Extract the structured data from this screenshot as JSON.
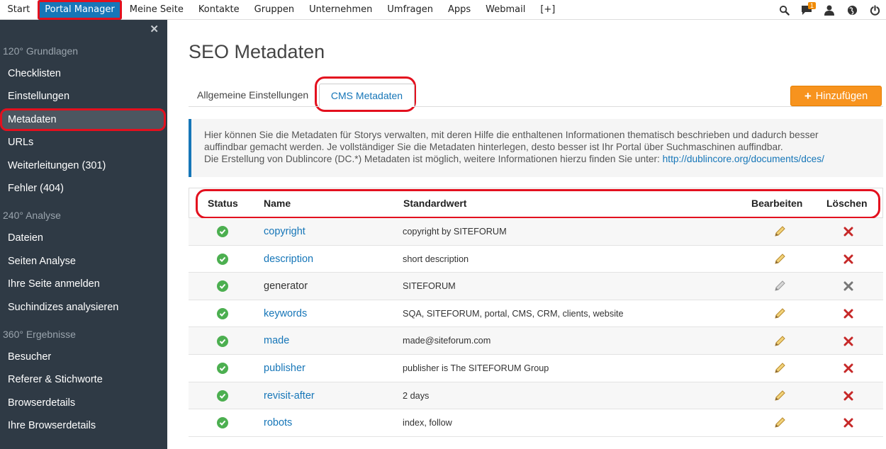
{
  "topnav": {
    "items": [
      "Start",
      "Portal Manager",
      "Meine Seite",
      "Kontakte",
      "Gruppen",
      "Unternehmen",
      "Umfragen",
      "Apps",
      "Webmail",
      "[+]"
    ],
    "active_index": 1,
    "notification_count": "1"
  },
  "sidebar": {
    "close_label": "✕",
    "sections": [
      {
        "label": "120° Grundlagen",
        "items": [
          "Checklisten",
          "Einstellungen",
          "Metadaten",
          "URLs",
          "Weiterleitungen (301)",
          "Fehler (404)"
        ]
      },
      {
        "label": "240° Analyse",
        "items": [
          "Dateien",
          "Seiten Analyse",
          "Ihre Seite anmelden",
          "Suchindizes analysieren"
        ]
      },
      {
        "label": "360° Ergebnisse",
        "items": [
          "Besucher",
          "Referer & Stichworte",
          "Browserdetails",
          "Ihre Browserdetails"
        ]
      }
    ],
    "active_item": "Metadaten"
  },
  "page": {
    "title": "SEO Metadaten",
    "tabs": [
      "Allgemeine Einstellungen",
      "CMS Metadaten"
    ],
    "active_tab": 1,
    "add_button": "Hinzufügen",
    "info_line1": "Hier können Sie die Metadaten für Storys verwalten, mit deren Hilfe die enthaltenen Informationen thematisch beschrieben und dadurch besser",
    "info_line2": "auffindbar gemacht werden. Je vollständiger Sie die Metadaten hinterlegen, desto besser ist Ihr Portal über Suchmaschinen auffindbar.",
    "info_line3": "Die Erstellung von Dublincore (DC.*) Metadaten ist möglich, weitere Informationen hierzu finden Sie unter: ",
    "info_link": "http://dublincore.org/documents/dces/"
  },
  "table": {
    "headers": {
      "status": "Status",
      "name": "Name",
      "default": "Standardwert",
      "edit": "Bearbeiten",
      "delete": "Löschen"
    },
    "rows": [
      {
        "name": "copyright",
        "value": "copyright by SITEFORUM",
        "editable": true
      },
      {
        "name": "description",
        "value": "short description",
        "editable": true
      },
      {
        "name": "generator",
        "value": "SITEFORUM",
        "editable": false
      },
      {
        "name": "keywords",
        "value": "SQA, SITEFORUM, portal, CMS, CRM, clients, website",
        "editable": true
      },
      {
        "name": "made",
        "value": "made@siteforum.com",
        "editable": true
      },
      {
        "name": "publisher",
        "value": "publisher is The SITEFORUM Group",
        "editable": true
      },
      {
        "name": "revisit-after",
        "value": "2 days",
        "editable": true
      },
      {
        "name": "robots",
        "value": "index, follow",
        "editable": true
      }
    ]
  },
  "colors": {
    "accent": "#1676b8",
    "highlight": "#e3101e",
    "button": "#f7931e",
    "sidebar": "#2f3a45",
    "status_ok": "#4caf50",
    "delete": "#c62828"
  }
}
